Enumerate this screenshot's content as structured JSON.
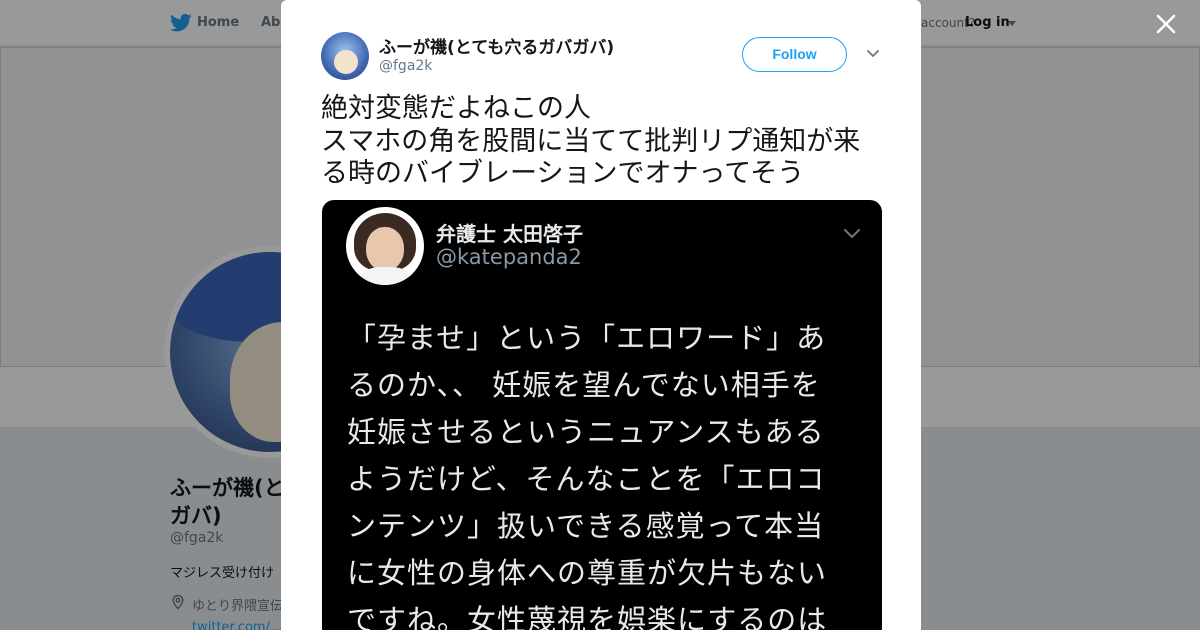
{
  "topbar": {
    "home_label": "Home",
    "about_label": "Abo",
    "account_prompt": "account?",
    "login_label": "Log in"
  },
  "profile": {
    "name_lines": [
      "ふーが禨(と",
      "ガバ)"
    ],
    "handle": "@fga2k",
    "bio": "マジレス受け付け",
    "location": "ゆとり界隈宣伝",
    "url": "twitter.com/..."
  },
  "modal": {
    "close_icon": "close-icon",
    "author": {
      "name": "ふーが禨(とても穴るガバガバ)",
      "handle": "@fga2k",
      "avatar_icon": "anime-avatar"
    },
    "follow_label": "Follow",
    "tweet_lines": [
      "絶対変態だよねこの人",
      "スマホの角を股間に当てて批判リプ通知が来",
      "る時のバイブレーションでオナってそう"
    ],
    "quoted": {
      "name": "弁護士 太田啓子",
      "handle": "@katepanda2",
      "body_lines": [
        "「孕ませ」という「エロワード」あ",
        "るのか、、 妊娠を望んでない相手を",
        "妊娠させるというニュアンスもある",
        "ようだけど、そんなことを「エロコ",
        "ンテンツ」扱いできる感覚って本当",
        "に女性の身体への尊重が欠片もない",
        "ですね。女性蔑視を娯楽にするのは"
      ]
    }
  },
  "colors": {
    "accent": "#1da1f2",
    "text": "#14171a",
    "muted": "#657786",
    "media_bg": "#000000"
  }
}
